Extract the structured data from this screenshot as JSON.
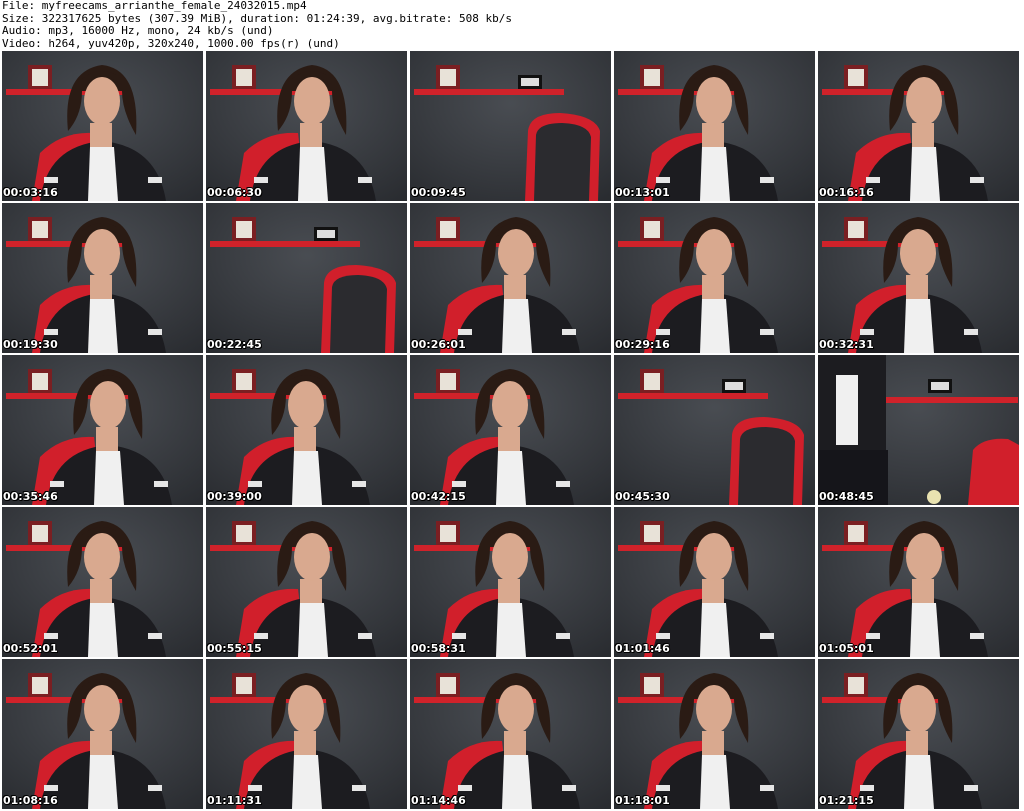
{
  "header": {
    "file_line": "File: myfreecams_arrianthe_female_24032015.mp4",
    "size_line": "Size: 322317625 bytes (307.39 MiB), duration: 01:24:39, avg.bitrate: 508 kb/s",
    "audio_line": "Audio: mp3, 16000 Hz, mono, 24 kb/s (und)",
    "video_line": "Video: h264, yuv420p, 320x240, 1000.00 fps(r) (und)"
  },
  "colors": {
    "wall": "#3a3d42",
    "shelf": "#d0222a",
    "chair": "#d11f2b",
    "chair_mesh": "#2b2b2f",
    "shirt": "#1c1c20",
    "blouse": "#f0f0f0",
    "hair": "#2a1b14",
    "skin": "#d9a98f"
  },
  "thumbnails": [
    {
      "time": "00:03:16",
      "scene": "person"
    },
    {
      "time": "00:06:30",
      "scene": "person"
    },
    {
      "time": "00:09:45",
      "scene": "empty"
    },
    {
      "time": "00:13:01",
      "scene": "person"
    },
    {
      "time": "00:16:16",
      "scene": "person"
    },
    {
      "time": "00:19:30",
      "scene": "person"
    },
    {
      "time": "00:22:45",
      "scene": "empty"
    },
    {
      "time": "00:26:01",
      "scene": "person"
    },
    {
      "time": "00:29:16",
      "scene": "person"
    },
    {
      "time": "00:32:31",
      "scene": "person"
    },
    {
      "time": "00:35:46",
      "scene": "person"
    },
    {
      "time": "00:39:00",
      "scene": "person"
    },
    {
      "time": "00:42:15",
      "scene": "person"
    },
    {
      "time": "00:45:30",
      "scene": "empty"
    },
    {
      "time": "00:48:45",
      "scene": "standing"
    },
    {
      "time": "00:52:01",
      "scene": "person"
    },
    {
      "time": "00:55:15",
      "scene": "person"
    },
    {
      "time": "00:58:31",
      "scene": "person"
    },
    {
      "time": "01:01:46",
      "scene": "person"
    },
    {
      "time": "01:05:01",
      "scene": "person"
    },
    {
      "time": "01:08:16",
      "scene": "person"
    },
    {
      "time": "01:11:31",
      "scene": "person"
    },
    {
      "time": "01:14:46",
      "scene": "person"
    },
    {
      "time": "01:18:01",
      "scene": "person"
    },
    {
      "time": "01:21:15",
      "scene": "person"
    }
  ]
}
